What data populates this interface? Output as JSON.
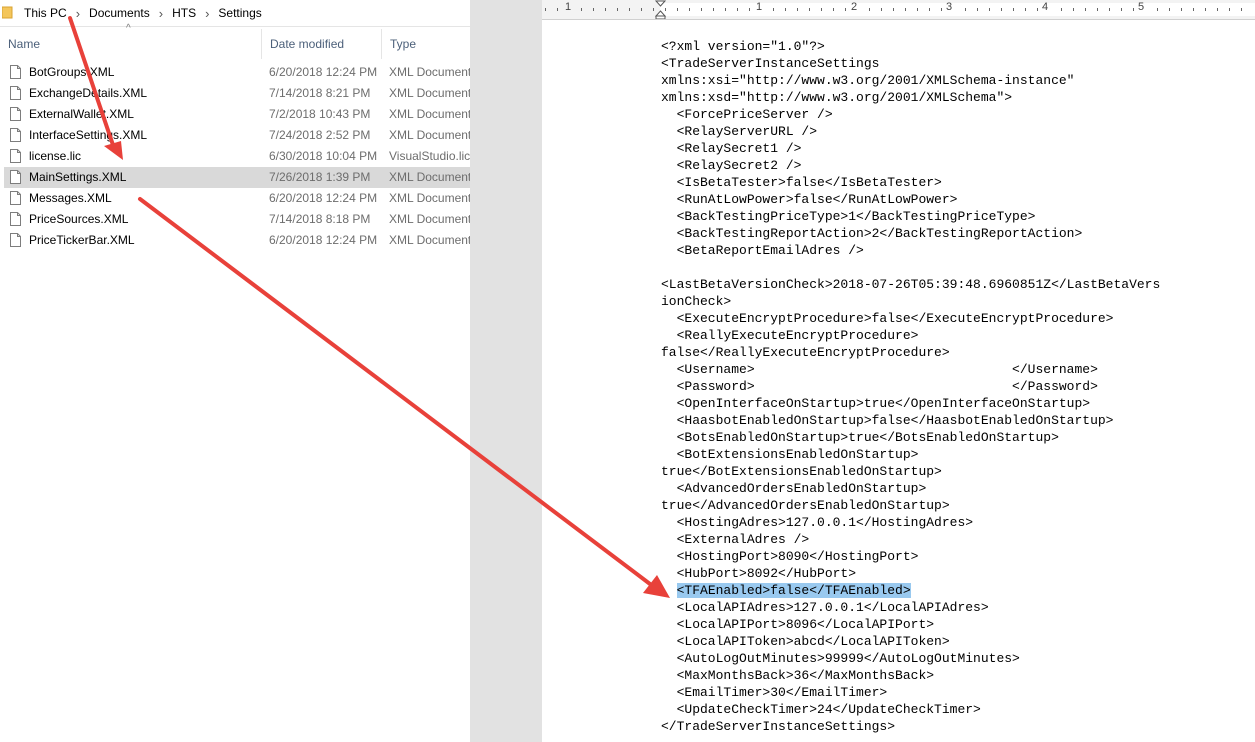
{
  "explorer": {
    "breadcrumb": [
      "This PC",
      "Documents",
      "HTS",
      "Settings"
    ],
    "columns": {
      "name": "Name",
      "date": "Date modified",
      "type": "Type"
    },
    "files": [
      {
        "name": "BotGroups.XML",
        "date": "6/20/2018 12:24 PM",
        "type": "XML Document",
        "icon": "xml-file-icon"
      },
      {
        "name": "ExchangeDetails.XML",
        "date": "7/14/2018 8:21 PM",
        "type": "XML Document",
        "icon": "xml-file-icon"
      },
      {
        "name": "ExternalWallet.XML",
        "date": "7/2/2018 10:43 PM",
        "type": "XML Document",
        "icon": "xml-file-icon"
      },
      {
        "name": "InterfaceSettings.XML",
        "date": "7/24/2018 2:52 PM",
        "type": "XML Document",
        "icon": "xml-file-icon"
      },
      {
        "name": "license.lic",
        "date": "6/30/2018 10:04 PM",
        "type": "VisualStudio.lic",
        "icon": "file-icon"
      },
      {
        "name": "MainSettings.XML",
        "date": "7/26/2018 1:39 PM",
        "type": "XML Document",
        "icon": "xml-file-icon",
        "selected": true
      },
      {
        "name": "Messages.XML",
        "date": "6/20/2018 12:24 PM",
        "type": "XML Document",
        "icon": "xml-file-icon"
      },
      {
        "name": "PriceSources.XML",
        "date": "7/14/2018 8:18 PM",
        "type": "XML Document",
        "icon": "xml-file-icon"
      },
      {
        "name": "PriceTickerBar.XML",
        "date": "6/20/2018 12:24 PM",
        "type": "XML Document",
        "icon": "xml-file-icon"
      }
    ]
  },
  "ruler": {
    "labels": [
      "1",
      "1",
      "2",
      "3",
      "4",
      "5"
    ]
  },
  "document": {
    "lines": [
      "<?xml version=\"1.0\"?>",
      "<TradeServerInstanceSettings",
      "xmlns:xsi=\"http://www.w3.org/2001/XMLSchema-instance\"",
      "xmlns:xsd=\"http://www.w3.org/2001/XMLSchema\">",
      "  <ForcePriceServer />",
      "  <RelayServerURL />",
      "  <RelaySecret1 />",
      "  <RelaySecret2 />",
      "  <IsBetaTester>false</IsBetaTester>",
      "  <RunAtLowPower>false</RunAtLowPower>",
      "  <BackTestingPriceType>1</BackTestingPriceType>",
      "  <BackTestingReportAction>2</BackTestingReportAction>",
      "  <BetaReportEmailAdres />",
      "",
      "<LastBetaVersionCheck>2018-07-26T05:39:48.6960851Z</LastBetaVers",
      "ionCheck>",
      "  <ExecuteEncryptProcedure>false</ExecuteEncryptProcedure>",
      "  <ReallyExecuteEncryptProcedure>",
      "false</ReallyExecuteEncryptProcedure>",
      "  <Username>                                 </Username>",
      "  <Password>                                 </Password>",
      "  <OpenInterfaceOnStartup>true</OpenInterfaceOnStartup>",
      "  <HaasbotEnabledOnStartup>false</HaasbotEnabledOnStartup>",
      "  <BotsEnabledOnStartup>true</BotsEnabledOnStartup>",
      "  <BotExtensionsEnabledOnStartup>",
      "true</BotExtensionsEnabledOnStartup>",
      "  <AdvancedOrdersEnabledOnStartup>",
      "true</AdvancedOrdersEnabledOnStartup>",
      "  <HostingAdres>127.0.0.1</HostingAdres>",
      "  <ExternalAdres />",
      "  <HostingPort>8090</HostingPort>",
      "  <HubPort>8092</HubPort>",
      "  <TFAEnabled>false</TFAEnabled>",
      "  <LocalAPIAdres>127.0.0.1</LocalAPIAdres>",
      "  <LocalAPIPort>8096</LocalAPIPort>",
      "  <LocalAPIToken>abcd</LocalAPIToken>",
      "  <AutoLogOutMinutes>99999</AutoLogOutMinutes>",
      "  <MaxMonthsBack>36</MaxMonthsBack>",
      "  <EmailTimer>30</EmailTimer>",
      "  <UpdateCheckTimer>24</UpdateCheckTimer>",
      "</TradeServerInstanceSettings>"
    ],
    "highlighted_line": 32
  },
  "colors": {
    "selection": "#d9d9d9",
    "highlight": "#99c9ef",
    "arrow": "#e8413a",
    "header_text": "#4c607a"
  }
}
